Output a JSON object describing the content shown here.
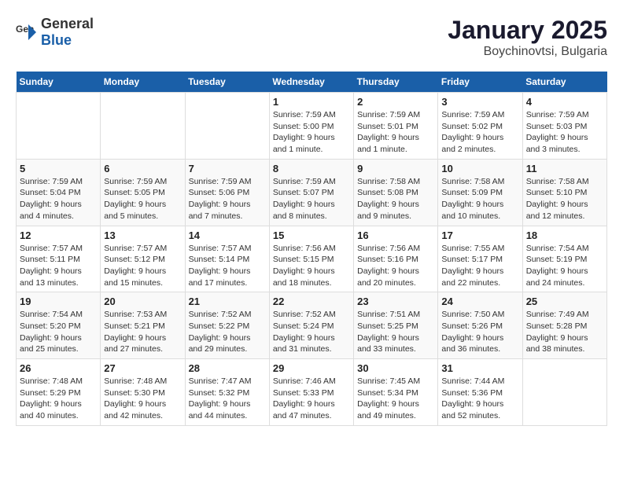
{
  "logo": {
    "general": "General",
    "blue": "Blue"
  },
  "title": "January 2025",
  "subtitle": "Boychinovtsi, Bulgaria",
  "days_of_week": [
    "Sunday",
    "Monday",
    "Tuesday",
    "Wednesday",
    "Thursday",
    "Friday",
    "Saturday"
  ],
  "weeks": [
    [
      {
        "day": "",
        "info": ""
      },
      {
        "day": "",
        "info": ""
      },
      {
        "day": "",
        "info": ""
      },
      {
        "day": "1",
        "info": "Sunrise: 7:59 AM\nSunset: 5:00 PM\nDaylight: 9 hours\nand 1 minute."
      },
      {
        "day": "2",
        "info": "Sunrise: 7:59 AM\nSunset: 5:01 PM\nDaylight: 9 hours\nand 1 minute."
      },
      {
        "day": "3",
        "info": "Sunrise: 7:59 AM\nSunset: 5:02 PM\nDaylight: 9 hours\nand 2 minutes."
      },
      {
        "day": "4",
        "info": "Sunrise: 7:59 AM\nSunset: 5:03 PM\nDaylight: 9 hours\nand 3 minutes."
      }
    ],
    [
      {
        "day": "5",
        "info": "Sunrise: 7:59 AM\nSunset: 5:04 PM\nDaylight: 9 hours\nand 4 minutes."
      },
      {
        "day": "6",
        "info": "Sunrise: 7:59 AM\nSunset: 5:05 PM\nDaylight: 9 hours\nand 5 minutes."
      },
      {
        "day": "7",
        "info": "Sunrise: 7:59 AM\nSunset: 5:06 PM\nDaylight: 9 hours\nand 7 minutes."
      },
      {
        "day": "8",
        "info": "Sunrise: 7:59 AM\nSunset: 5:07 PM\nDaylight: 9 hours\nand 8 minutes."
      },
      {
        "day": "9",
        "info": "Sunrise: 7:58 AM\nSunset: 5:08 PM\nDaylight: 9 hours\nand 9 minutes."
      },
      {
        "day": "10",
        "info": "Sunrise: 7:58 AM\nSunset: 5:09 PM\nDaylight: 9 hours\nand 10 minutes."
      },
      {
        "day": "11",
        "info": "Sunrise: 7:58 AM\nSunset: 5:10 PM\nDaylight: 9 hours\nand 12 minutes."
      }
    ],
    [
      {
        "day": "12",
        "info": "Sunrise: 7:57 AM\nSunset: 5:11 PM\nDaylight: 9 hours\nand 13 minutes."
      },
      {
        "day": "13",
        "info": "Sunrise: 7:57 AM\nSunset: 5:12 PM\nDaylight: 9 hours\nand 15 minutes."
      },
      {
        "day": "14",
        "info": "Sunrise: 7:57 AM\nSunset: 5:14 PM\nDaylight: 9 hours\nand 17 minutes."
      },
      {
        "day": "15",
        "info": "Sunrise: 7:56 AM\nSunset: 5:15 PM\nDaylight: 9 hours\nand 18 minutes."
      },
      {
        "day": "16",
        "info": "Sunrise: 7:56 AM\nSunset: 5:16 PM\nDaylight: 9 hours\nand 20 minutes."
      },
      {
        "day": "17",
        "info": "Sunrise: 7:55 AM\nSunset: 5:17 PM\nDaylight: 9 hours\nand 22 minutes."
      },
      {
        "day": "18",
        "info": "Sunrise: 7:54 AM\nSunset: 5:19 PM\nDaylight: 9 hours\nand 24 minutes."
      }
    ],
    [
      {
        "day": "19",
        "info": "Sunrise: 7:54 AM\nSunset: 5:20 PM\nDaylight: 9 hours\nand 25 minutes."
      },
      {
        "day": "20",
        "info": "Sunrise: 7:53 AM\nSunset: 5:21 PM\nDaylight: 9 hours\nand 27 minutes."
      },
      {
        "day": "21",
        "info": "Sunrise: 7:52 AM\nSunset: 5:22 PM\nDaylight: 9 hours\nand 29 minutes."
      },
      {
        "day": "22",
        "info": "Sunrise: 7:52 AM\nSunset: 5:24 PM\nDaylight: 9 hours\nand 31 minutes."
      },
      {
        "day": "23",
        "info": "Sunrise: 7:51 AM\nSunset: 5:25 PM\nDaylight: 9 hours\nand 33 minutes."
      },
      {
        "day": "24",
        "info": "Sunrise: 7:50 AM\nSunset: 5:26 PM\nDaylight: 9 hours\nand 36 minutes."
      },
      {
        "day": "25",
        "info": "Sunrise: 7:49 AM\nSunset: 5:28 PM\nDaylight: 9 hours\nand 38 minutes."
      }
    ],
    [
      {
        "day": "26",
        "info": "Sunrise: 7:48 AM\nSunset: 5:29 PM\nDaylight: 9 hours\nand 40 minutes."
      },
      {
        "day": "27",
        "info": "Sunrise: 7:48 AM\nSunset: 5:30 PM\nDaylight: 9 hours\nand 42 minutes."
      },
      {
        "day": "28",
        "info": "Sunrise: 7:47 AM\nSunset: 5:32 PM\nDaylight: 9 hours\nand 44 minutes."
      },
      {
        "day": "29",
        "info": "Sunrise: 7:46 AM\nSunset: 5:33 PM\nDaylight: 9 hours\nand 47 minutes."
      },
      {
        "day": "30",
        "info": "Sunrise: 7:45 AM\nSunset: 5:34 PM\nDaylight: 9 hours\nand 49 minutes."
      },
      {
        "day": "31",
        "info": "Sunrise: 7:44 AM\nSunset: 5:36 PM\nDaylight: 9 hours\nand 52 minutes."
      },
      {
        "day": "",
        "info": ""
      }
    ]
  ]
}
